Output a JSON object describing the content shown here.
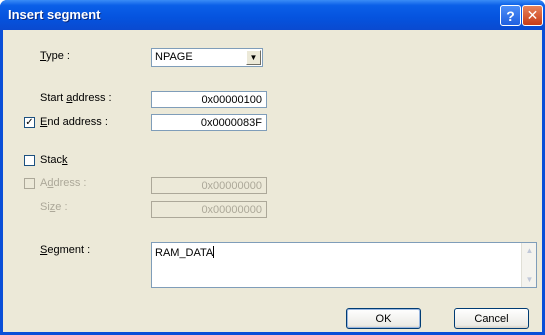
{
  "window": {
    "title": "Insert segment",
    "help_glyph": "?",
    "close_glyph": "✕"
  },
  "form": {
    "type_label_u": "T",
    "type_label_rest": "ype :",
    "type_value": "NPAGE",
    "start_label_pre": "Start ",
    "start_label_u": "a",
    "start_label_rest": "ddress :",
    "start_value": "0x00000100",
    "end_checked": true,
    "end_label_u": "E",
    "end_label_rest": "nd address :",
    "end_value": "0x0000083F",
    "stack_checked": false,
    "stack_label_pre": "Stac",
    "stack_label_u": "k",
    "address_checked": false,
    "address_label_pre": "A",
    "address_label_u": "d",
    "address_label_rest": "dress :",
    "address_value": "0x00000000",
    "size_label_pre": "Si",
    "size_label_u": "z",
    "size_label_rest": "e :",
    "size_value": "0x00000000",
    "segment_label_u": "S",
    "segment_label_rest": "egment :",
    "segment_value": "RAM_DATA"
  },
  "buttons": {
    "ok": "OK",
    "cancel": "Cancel"
  },
  "icons": {
    "dropdown": "chevron-down-icon",
    "checkmark": "checkmark-icon",
    "scroll_up": "scroll-up-icon",
    "scroll_down": "scroll-down-icon"
  }
}
